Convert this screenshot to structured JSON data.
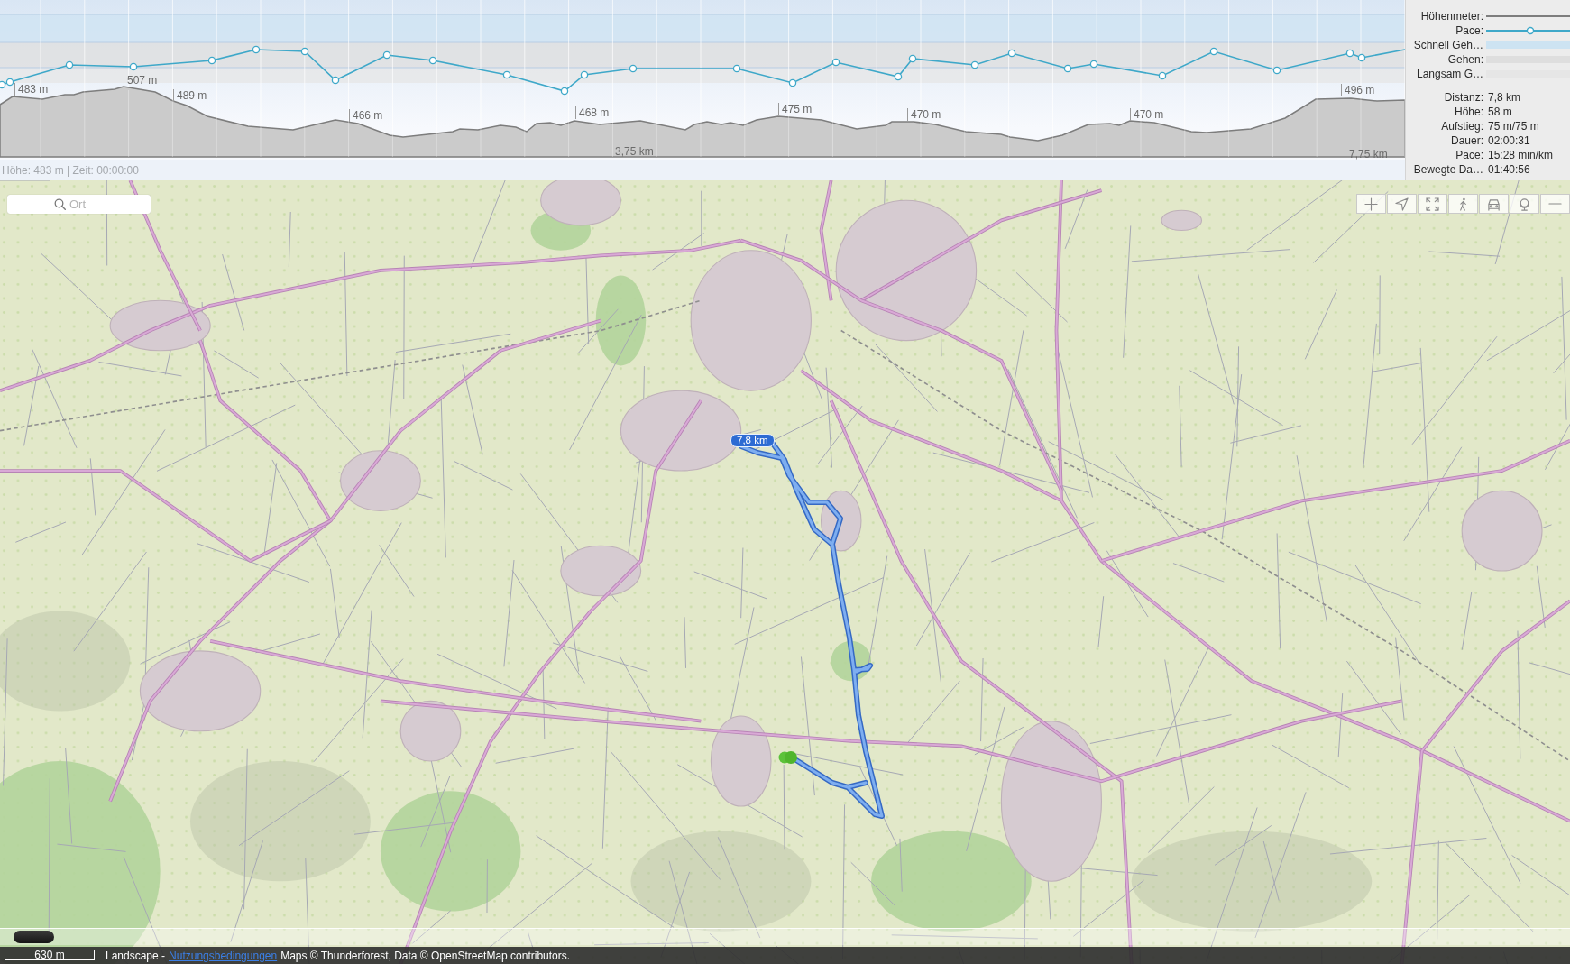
{
  "elevation_chart": {
    "labels": [
      "483 m",
      "507 m",
      "489 m",
      "466 m",
      "468 m",
      "475 m",
      "470 m",
      "470 m",
      "496 m"
    ],
    "distance_marks": [
      "3,75 km",
      "7,75 km"
    ]
  },
  "cursor_readout": "Höhe: 483 m | Zeit: 00:00:00",
  "legend": [
    {
      "label": "Höhenmeter:",
      "kind": "line",
      "color": "#7d7d7d"
    },
    {
      "label": "Pace:",
      "kind": "marker-line",
      "color": "#3ea8c9"
    },
    {
      "label": "Schnell Geh…",
      "kind": "band",
      "color": "#cde3f2"
    },
    {
      "label": "Gehen:",
      "kind": "band",
      "color": "#dedede"
    },
    {
      "label": "Langsam G…",
      "kind": "band",
      "color": "#e6e6e6"
    }
  ],
  "stats": [
    {
      "label": "Distanz:",
      "value": "7,8 km"
    },
    {
      "label": "Höhe:",
      "value": "58 m"
    },
    {
      "label": "Aufstieg:",
      "value": "75 m/75 m"
    },
    {
      "label": "Dauer:",
      "value": "02:00:31"
    },
    {
      "label": "Pace:",
      "value": "15:28 min/km"
    },
    {
      "label": "Bewegte Da…",
      "value": "01:40:56"
    }
  ],
  "map": {
    "search": {
      "placeholder": "Ort"
    },
    "route": {
      "distance": "7,8 km"
    }
  },
  "footer": {
    "scale": "630 m",
    "layer": "Landscape -",
    "link": "Nutzungsbedingungen",
    "attribution": "Maps © Thunderforest, Data © OpenStreetMap contributors."
  }
}
